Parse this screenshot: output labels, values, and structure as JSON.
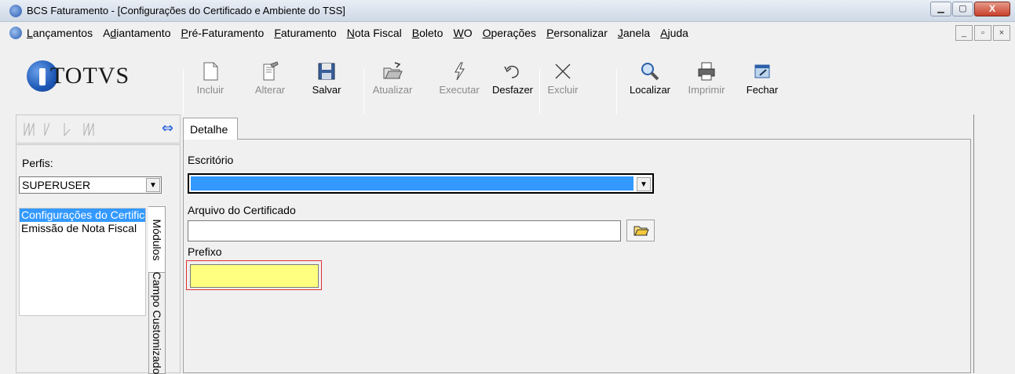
{
  "window": {
    "title": "BCS Faturamento - [Configurações do Certificado e Ambiente do TSS]",
    "controls": {
      "minimize": "▁",
      "maximize": "▢",
      "close": "X"
    }
  },
  "menu": {
    "items": [
      {
        "label": "Lançamentos",
        "accel": "L"
      },
      {
        "label": "Adiantamento",
        "accel": "d"
      },
      {
        "label": "Pré-Faturamento",
        "accel": "P"
      },
      {
        "label": "Faturamento",
        "accel": "F"
      },
      {
        "label": "Nota Fiscal",
        "accel": "N"
      },
      {
        "label": "Boleto",
        "accel": "B"
      },
      {
        "label": "WO",
        "accel": "W"
      },
      {
        "label": "Operações",
        "accel": "O"
      },
      {
        "label": "Personalizar",
        "accel": "P"
      },
      {
        "label": "Janela",
        "accel": "J"
      },
      {
        "label": "Ajuda",
        "accel": "A"
      }
    ],
    "mdi_controls": [
      "_",
      "▫",
      "×"
    ]
  },
  "brand": {
    "logo_text": "TOTVS"
  },
  "toolbar": {
    "buttons": [
      {
        "label": "Incluir",
        "icon": "new-document-icon",
        "enabled": false
      },
      {
        "label": "Alterar",
        "icon": "edit-document-icon",
        "enabled": false
      },
      {
        "label": "Salvar",
        "icon": "save-icon",
        "enabled": true
      },
      {
        "label": "Atualizar",
        "icon": "open-folder-icon",
        "enabled": false
      },
      {
        "label": "Executar",
        "icon": "lightning-icon",
        "enabled": false
      },
      {
        "label": "Desfazer",
        "icon": "undo-icon",
        "enabled": true
      },
      {
        "label": "Excluir",
        "icon": "delete-x-icon",
        "enabled": false
      },
      {
        "label": "Localizar",
        "icon": "magnifier-icon",
        "enabled": true
      },
      {
        "label": "Imprimir",
        "icon": "printer-icon",
        "enabled": false
      },
      {
        "label": "Fechar",
        "icon": "close-window-icon",
        "enabled": true
      }
    ]
  },
  "nav": {
    "arrows": "⋈ ⌵ ⌵ ⋈",
    "swap_icon": "⇔"
  },
  "sidebar": {
    "perfis_label": "Perfis:",
    "perfis_value": "SUPERUSER",
    "modules": [
      {
        "label": "Configurações do Certificado e Ambiente do TSS",
        "selected": true
      },
      {
        "label": "Emissão de Nota Fiscal",
        "selected": false
      }
    ],
    "tabs": [
      "Módulos",
      "Campo Customizado"
    ]
  },
  "main": {
    "tab_label": "Detalhe",
    "escritorio_label": "Escritório",
    "escritorio_value": "",
    "arquivo_label": "Arquivo do Certificado",
    "arquivo_value": "",
    "prefixo_label": "Prefixo",
    "prefixo_value": ""
  },
  "colors": {
    "selection": "#3399ff",
    "required_field": "#ffff80",
    "focus_border": "#e03030"
  }
}
